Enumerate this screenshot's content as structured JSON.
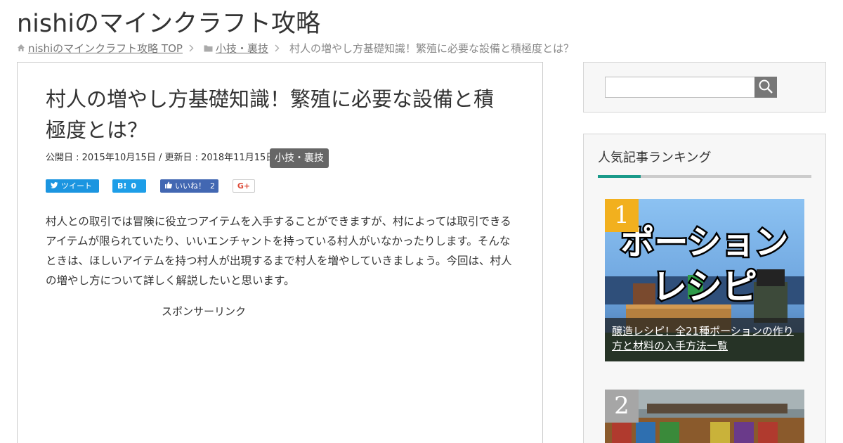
{
  "site": {
    "title": "nishiのマインクラフト攻略"
  },
  "breadcrumb": {
    "home": "nishiのマインクラフト攻略 TOP",
    "category": "小技・裏技",
    "current": "村人の増やし方基礎知識！繁殖に必要な設備と積極度とは？"
  },
  "article": {
    "title": "村人の増やし方基礎知識！繁殖に必要な設備と積極度とは？",
    "dates": "公開日 : 2015年10月15日 / 更新日 : 2018年11月15日",
    "category": "小技・裏技",
    "body": "村人との取引では冒険に役立つアイテムを入手することができますが、村によっては取引できるアイテムが限られていたり、いいエンチャントを持っている村人がいなかったりします。そんなときは、ほしいアイテムを持つ村人が出現するまで村人を増やしていきましょう。今回は、村人の増やし方について詳しく解説したいと思います。",
    "sponsor": "スポンサーリンク"
  },
  "share": {
    "tweet_label": "ツイート",
    "hatena_label": "B!",
    "hatena_count": "0",
    "like_label": "いいね！",
    "like_count": "2",
    "gplus_label": "G+"
  },
  "search": {
    "value": ""
  },
  "ranking": {
    "title": "人気記事ランキング",
    "items": [
      {
        "rank": "1",
        "title": "醸造レシピ！全21種ポーションの作り方と材料の入手方法一覧",
        "thumb_text_1": "ポーション",
        "thumb_text_2": "レシピ"
      },
      {
        "rank": "2"
      }
    ]
  },
  "colors": {
    "rank1": "#f2b01e",
    "rank2": "#a6a6a6",
    "accent": "#1a9a8a",
    "twitter": "#1b95e0",
    "hatena": "#1d9ee8",
    "facebook": "#4267b2",
    "gplus": "#dd4b39",
    "badge": "#666666"
  },
  "icons": {
    "home": "home-icon",
    "folder": "folder-icon",
    "chevron": "chevron-right-icon",
    "search": "search-icon",
    "twitter": "twitter-icon",
    "like": "thumbs-up-icon"
  }
}
